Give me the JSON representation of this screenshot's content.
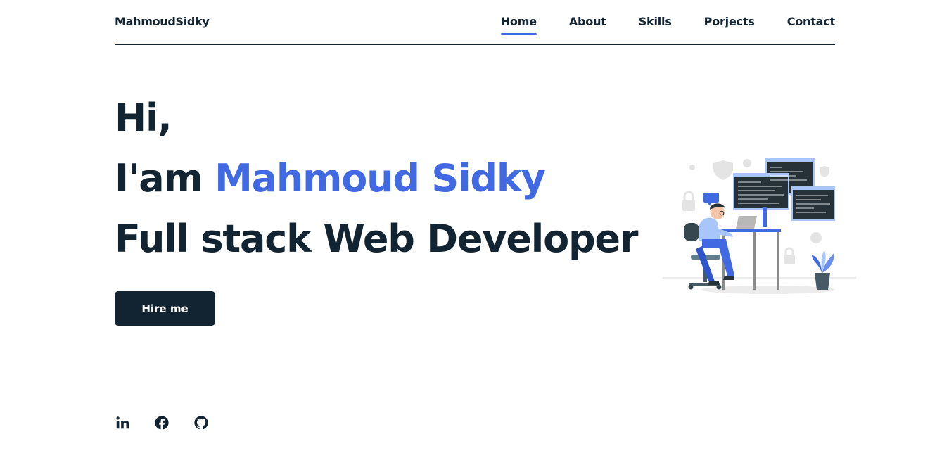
{
  "header": {
    "logo": "MahmoudSidky",
    "nav": [
      {
        "label": "Home",
        "active": true
      },
      {
        "label": "About",
        "active": false
      },
      {
        "label": "Skills",
        "active": false
      },
      {
        "label": "Porjects",
        "active": false
      },
      {
        "label": "Contact",
        "active": false
      }
    ]
  },
  "hero": {
    "greeting": "Hi,",
    "intro_prefix": "I'am ",
    "name": "Mahmoud Sidky",
    "role": "Full stack Web Developer",
    "cta_label": "Hire me"
  },
  "illustration": {
    "icon": "developer-at-desk-illustration"
  },
  "socials": [
    {
      "icon": "linkedin-icon"
    },
    {
      "icon": "facebook-icon"
    },
    {
      "icon": "github-icon"
    }
  ],
  "colors": {
    "primary": "#122331",
    "accent": "#4169e1",
    "background": "#ffffff"
  }
}
